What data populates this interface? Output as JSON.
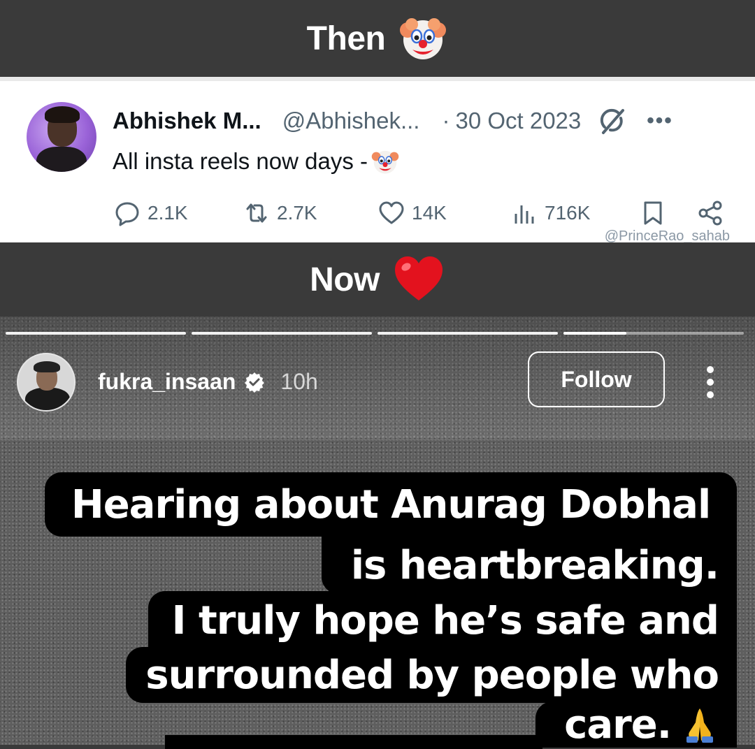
{
  "banners": {
    "then": {
      "label": "Then",
      "emoji": "clown-face-icon"
    },
    "now": {
      "label": "Now",
      "emoji": "red-heart-icon"
    }
  },
  "tweet": {
    "display_name": "Abhishek M...",
    "handle": "@Abhishek...",
    "separator": "·",
    "date": "30 Oct 2023",
    "text": "All insta reels now days -",
    "text_emoji": "clown-face-icon",
    "actions": {
      "replies": "2.1K",
      "reposts": "2.7K",
      "likes": "14K",
      "views": "716K"
    },
    "watermark": "@PrinceRao_sahab"
  },
  "story": {
    "username": "fukra_insaan",
    "time_ago": "10h",
    "follow_label": "Follow",
    "progress_segments": [
      1,
      1,
      1,
      0.35
    ],
    "caption_lines": [
      "Hearing about Anurag Dobhal",
      "is heartbreaking.",
      "I truly hope he’s safe and",
      "surrounded by people who",
      "care."
    ],
    "caption_emoji": "folded-hands-icon"
  },
  "colors": {
    "banner_bg": "#3a3a3a",
    "tweet_text": "#0f1419",
    "tweet_muted": "#536471",
    "caption_bg": "#000000"
  }
}
